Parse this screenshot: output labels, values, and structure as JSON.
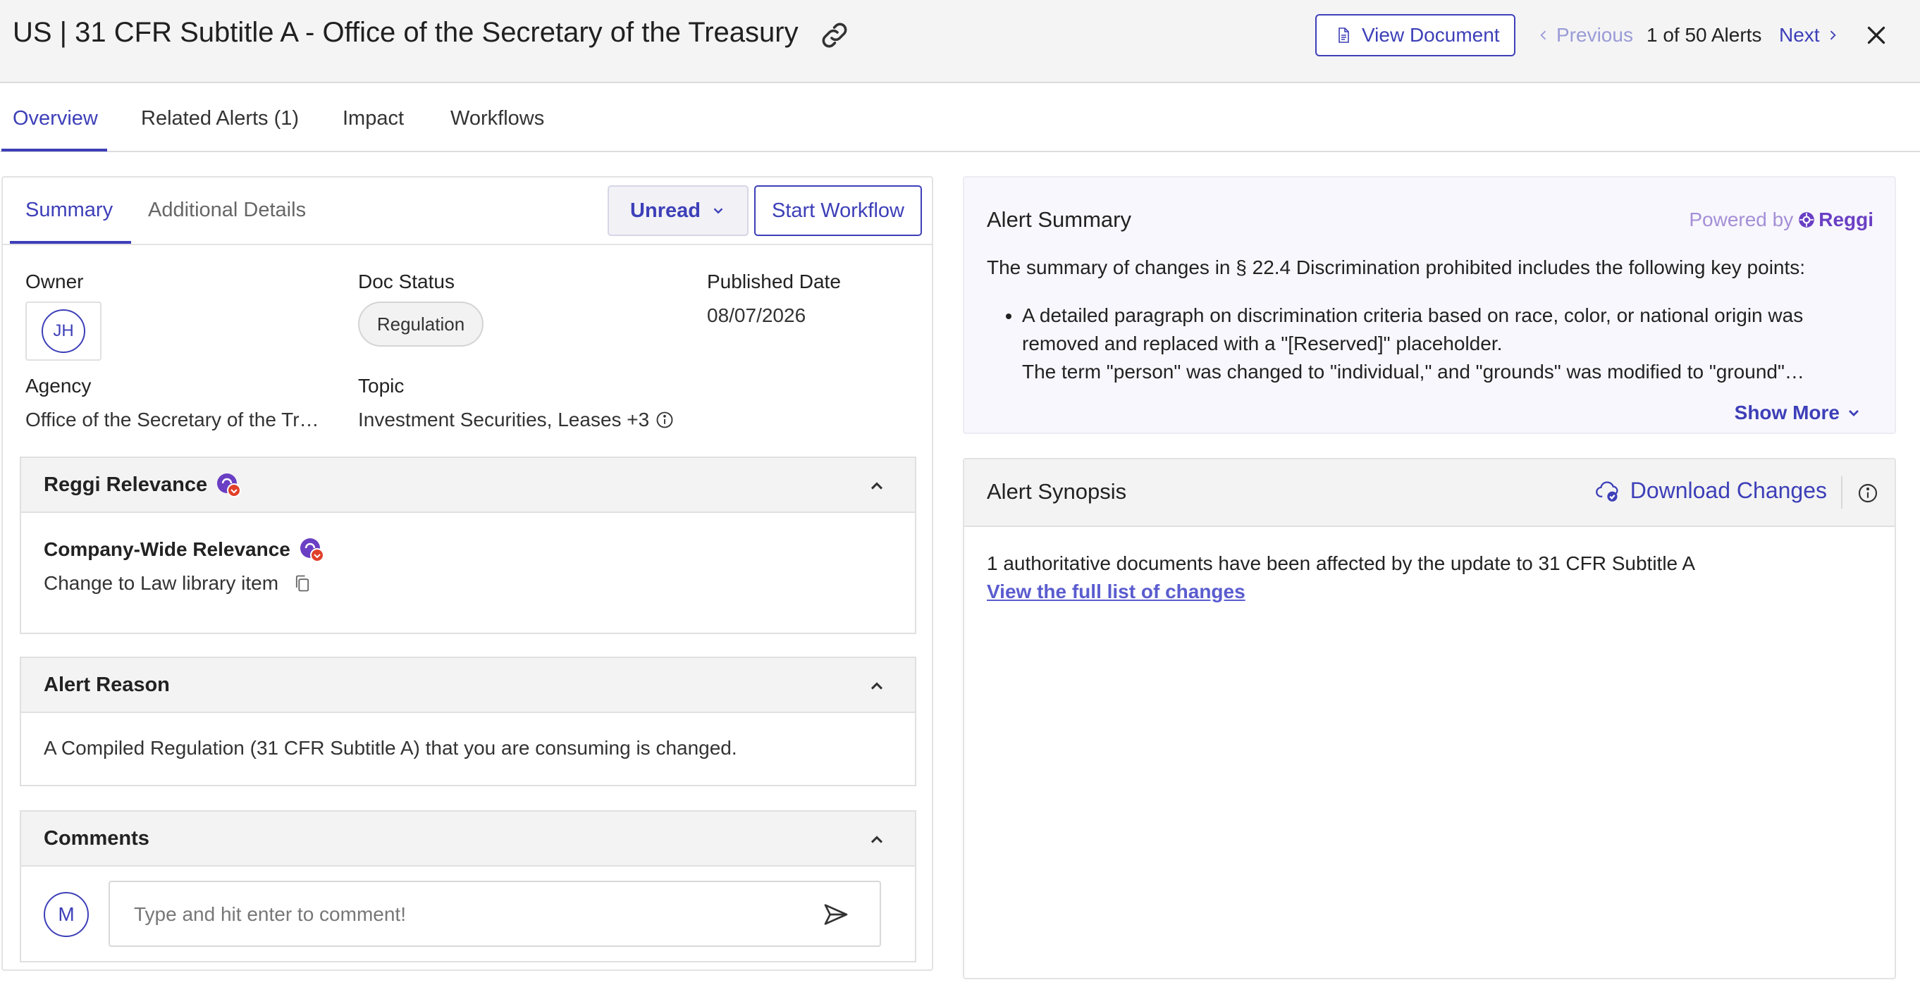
{
  "header": {
    "title": "US | 31 CFR Subtitle A - Office of the Secretary of the Treasury",
    "view_document": "View Document",
    "previous": "Previous",
    "pager": "1 of 50 Alerts",
    "next": "Next"
  },
  "tabs": [
    {
      "label": "Overview",
      "active": true
    },
    {
      "label": "Related Alerts (1)"
    },
    {
      "label": "Impact"
    },
    {
      "label": "Workflows"
    }
  ],
  "left": {
    "subtabs": [
      {
        "label": "Summary",
        "active": true
      },
      {
        "label": "Additional Details"
      }
    ],
    "status_button": "Unread",
    "start_workflow": "Start Workflow",
    "fields": {
      "owner_label": "Owner",
      "owner_initials": "JH",
      "doc_status_label": "Doc Status",
      "doc_status_value": "Regulation",
      "published_label": "Published Date",
      "published_value": "08/07/2026",
      "agency_label": "Agency",
      "agency_value": "Office of the Secretary of the Tr…",
      "topic_label": "Topic",
      "topic_value": "Investment Securities, Leases +3"
    },
    "relevance": {
      "title": "Reggi Relevance",
      "subtitle": "Company-Wide Relevance",
      "text": "Change to Law library item"
    },
    "reason": {
      "title": "Alert Reason",
      "text": "A Compiled Regulation (31 CFR Subtitle A) that you are consuming is changed."
    },
    "comments": {
      "title": "Comments",
      "avatar": "M",
      "placeholder": "Type and hit enter to comment!"
    }
  },
  "summary": {
    "title": "Alert Summary",
    "powered_by": "Powered by",
    "brand": "Reggi",
    "intro": "The summary of changes in § 22.4 Discrimination prohibited includes the following key points:",
    "bullets": [
      "A detailed paragraph on discrimination criteria based on race, color, or national origin was removed and replaced with a \"[Reserved]\" placeholder.",
      "The term \"person\" was changed to \"individual,\" and \"grounds\" was modified to \"ground\"…"
    ],
    "show_more": "Show More"
  },
  "synopsis": {
    "title": "Alert Synopsis",
    "download": "Download Changes",
    "text": "1 authoritative documents have been affected by the update to 31 CFR Subtitle A",
    "link": "View the full list of changes"
  },
  "colors": {
    "accent": "#3d3fb8",
    "brand_purple": "#6a3fc4",
    "badge_red": "#e0402a"
  }
}
